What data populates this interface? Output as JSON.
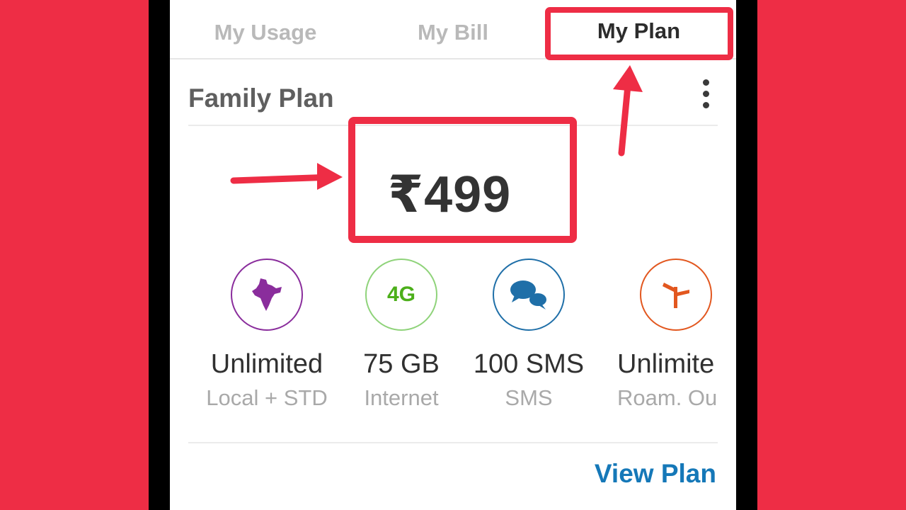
{
  "tabs": [
    {
      "label": "My Usage",
      "active": false
    },
    {
      "label": "My Bill",
      "active": false
    },
    {
      "label": "My Plan",
      "active": true
    }
  ],
  "plan": {
    "title": "Family Plan",
    "price": "₹499",
    "view_plan_label": "View Plan"
  },
  "features": [
    {
      "icon": "india-map-icon",
      "value": "Unlimited",
      "sub": "Local + STD",
      "color": "#8a2d9c"
    },
    {
      "icon": "4g-icon",
      "badge": "4G",
      "value": "75 GB",
      "sub": "Internet",
      "color": "#4caf1a"
    },
    {
      "icon": "chat-bubbles-icon",
      "value": "100 SMS",
      "sub": "SMS",
      "color": "#1f6fa8"
    },
    {
      "icon": "roaming-signpost-icon",
      "value": "Unlimite",
      "sub": "Roam. Ou",
      "color": "#e2571f"
    }
  ],
  "colors": {
    "background": "#ee2d45",
    "annotation": "#ee2d45",
    "accent_link": "#1578b8"
  }
}
